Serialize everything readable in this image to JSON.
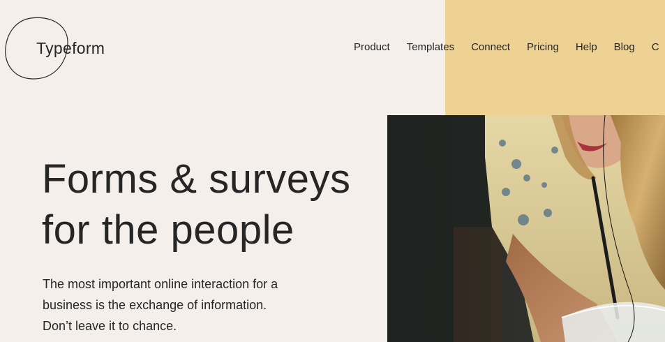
{
  "brand": {
    "name": "Typeform"
  },
  "nav": {
    "items": [
      {
        "label": "Product"
      },
      {
        "label": "Templates"
      },
      {
        "label": "Connect"
      },
      {
        "label": "Pricing"
      },
      {
        "label": "Help"
      },
      {
        "label": "Blog"
      },
      {
        "label": "C"
      }
    ]
  },
  "hero": {
    "title_line1": "Forms & surveys",
    "title_line2": "for the people",
    "description": "The most important online interaction for a business is the exchange of information. Don’t leave it to chance."
  },
  "colors": {
    "background": "#f4efea",
    "accent_yellow": "#edd293",
    "text": "#262627"
  }
}
